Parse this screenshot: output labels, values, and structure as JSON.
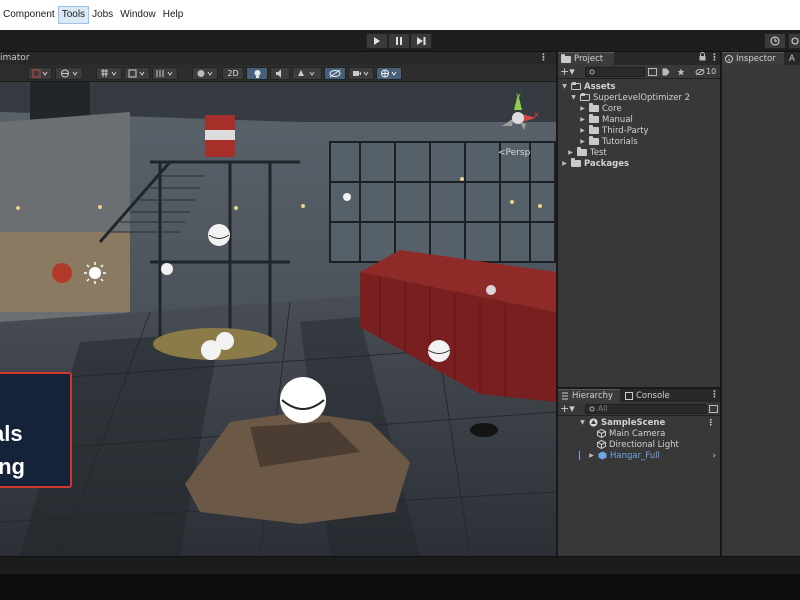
{
  "menu": [
    "Component",
    "Tools",
    "Jobs",
    "Window",
    "Help"
  ],
  "menu_highlighted": "Tools",
  "scene": {
    "tab_title": "imator",
    "toolbar_2d_label": "2D",
    "persp_label": "<Persp",
    "gizmo_axis_y": "y",
    "gizmo_axis_x": "x",
    "overlay_lines": [
      ":",
      "als",
      "ing"
    ]
  },
  "project": {
    "tab_label": "Project",
    "hidden_count": "10",
    "tree": [
      {
        "label": "Assets",
        "depth": 0,
        "expanded": true,
        "bold": true
      },
      {
        "label": "SuperLevelOptimizer 2",
        "depth": 1,
        "expanded": true
      },
      {
        "label": "Core",
        "depth": 2,
        "expanded": false
      },
      {
        "label": "Manual",
        "depth": 2,
        "expanded": false
      },
      {
        "label": "Third-Party",
        "depth": 2,
        "expanded": false
      },
      {
        "label": "Tutorials",
        "depth": 2,
        "expanded": false
      },
      {
        "label": "Test",
        "depth": 1,
        "expanded": false
      },
      {
        "label": "Packages",
        "depth": 0,
        "expanded": false,
        "bold": true
      }
    ]
  },
  "hierarchy": {
    "tab_label": "Hierarchy",
    "console_tab_label": "Console",
    "search_placeholder": "All",
    "scene_name": "SampleScene",
    "items": [
      {
        "label": "Main Camera",
        "depth": 1
      },
      {
        "label": "Directional Light",
        "depth": 1
      },
      {
        "label": "Hangar_Full",
        "depth": 1,
        "prefab": true
      }
    ]
  },
  "inspector": {
    "tab_label": "Inspector",
    "second_tab_label": "A"
  },
  "colors": {
    "prefab_blue": "#6fa6e6",
    "overlay_border": "#d13a2a",
    "container_red": "#7a1f1f"
  }
}
